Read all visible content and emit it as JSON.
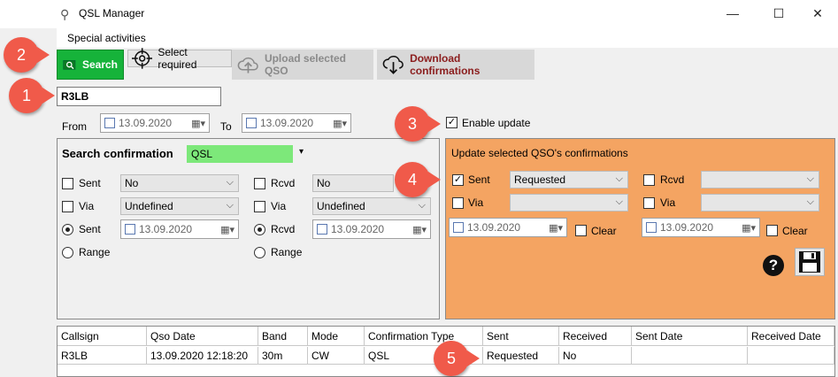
{
  "window": {
    "title": "QSL Manager"
  },
  "menu": {
    "special_activities": "Special activities"
  },
  "toolbar": {
    "search_label": "Search",
    "select_required_label": "Select required",
    "upload_label": "Upload selected QSO",
    "download_label": "Download confirmations"
  },
  "callsign": {
    "value": "R3LB"
  },
  "range": {
    "from_label": "From",
    "from_date": "13.09.2020",
    "to_label": "To",
    "to_date": "13.09.2020",
    "enable_update_label": "Enable update"
  },
  "search_panel": {
    "title": "Search confirmation",
    "type_value": "QSL",
    "sent_label": "Sent",
    "sent_value": "No",
    "rcvd_label": "Rcvd",
    "rcvd_value": "No",
    "via_label": "Via",
    "via_value": "Undefined",
    "via2_label": "Via",
    "via2_value": "Undefined",
    "radio_sent_label": "Sent",
    "radio_sent_date": "13.09.2020",
    "radio_rcvd_label": "Rcvd",
    "radio_rcvd_date": "13.09.2020",
    "range_label": "Range",
    "range2_label": "Range"
  },
  "update_panel": {
    "title": "Update selected QSO's confirmations",
    "sent_label": "Sent",
    "sent_value": "Requested",
    "rcvd_label": "Rcvd",
    "via_label": "Via",
    "via2_label": "Via",
    "sent_date": "13.09.2020",
    "rcvd_date": "13.09.2020",
    "clear_label": "Clear",
    "clear2_label": "Clear"
  },
  "grid": {
    "headers": [
      "Callsign",
      "Qso Date",
      "Band",
      "Mode",
      "Confirmation Type",
      "Sent",
      "Received",
      "Sent Date",
      "Received Date"
    ],
    "row": [
      "R3LB",
      "13.09.2020 12:18:20",
      "30m",
      "CW",
      "QSL",
      "Requested",
      "No",
      "",
      ""
    ]
  },
  "badges": [
    "1",
    "2",
    "3",
    "4",
    "5"
  ],
  "colors": {
    "search_green": "#16b33a",
    "update_orange": "#f4a462",
    "badge_red": "#f05a4a",
    "type_green": "#7de87a"
  },
  "icons": [
    "antenna-icon",
    "search-magnifier-icon",
    "crosshair-icon",
    "cloud-upload-icon",
    "cloud-download-icon",
    "calendar-icon",
    "help-icon",
    "save-disk-icon"
  ]
}
